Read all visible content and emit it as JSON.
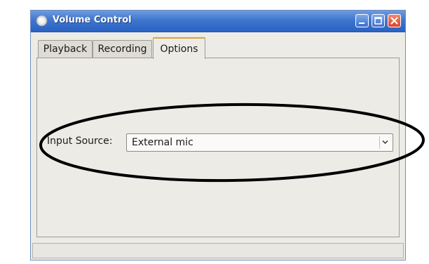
{
  "window": {
    "title": "Volume Control",
    "title_bar_color": "#3f76cf",
    "icons": [
      "app-volume-icon",
      "minimize-icon",
      "maximize-icon",
      "close-icon"
    ]
  },
  "tabs": [
    {
      "label": "Playback",
      "selected": false
    },
    {
      "label": "Recording",
      "selected": false
    },
    {
      "label": "Options",
      "selected": true
    }
  ],
  "options": {
    "input_source_label": "Input Source:",
    "input_source_value": "External mic"
  },
  "annotation": {
    "shape": "ellipse",
    "color": "#000000",
    "encircles": "input-source-row"
  }
}
